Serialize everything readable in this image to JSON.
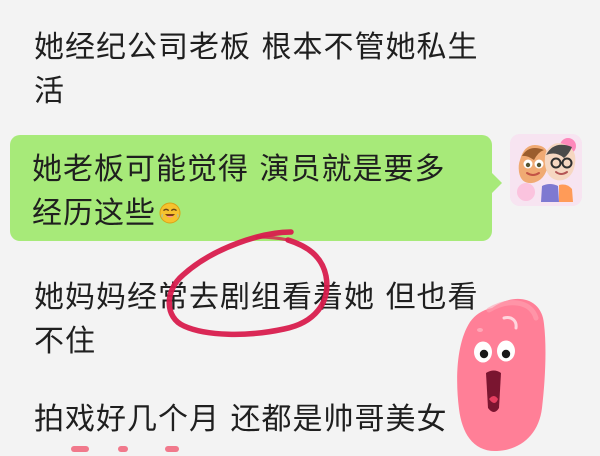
{
  "chat": {
    "messages": [
      {
        "text": "她经纪公司老板  根本不管她私生活"
      },
      {
        "text": "她老板可能觉得 演员就是要多经历这些",
        "emoji": "laughing-crying-emoji"
      },
      {
        "text": "她妈妈经常去剧组看着她   但也看不住"
      },
      {
        "text": "拍戏好几个月 还都是帅哥美女"
      }
    ]
  },
  "colors": {
    "background": "#f3f3f3",
    "outgoing_bubble": "#a7ea79",
    "annotation_red": "#d81c4d",
    "sticker_pink": "#ff7f97",
    "text": "#1f1f1f"
  },
  "icons": {
    "avatar": "cartoon-couple-avatar-icon",
    "emoji": "laughing-crying-emoji-icon",
    "sticker": "pink-worm-sticker-icon",
    "annotation": "red-circle-annotation-icon"
  }
}
